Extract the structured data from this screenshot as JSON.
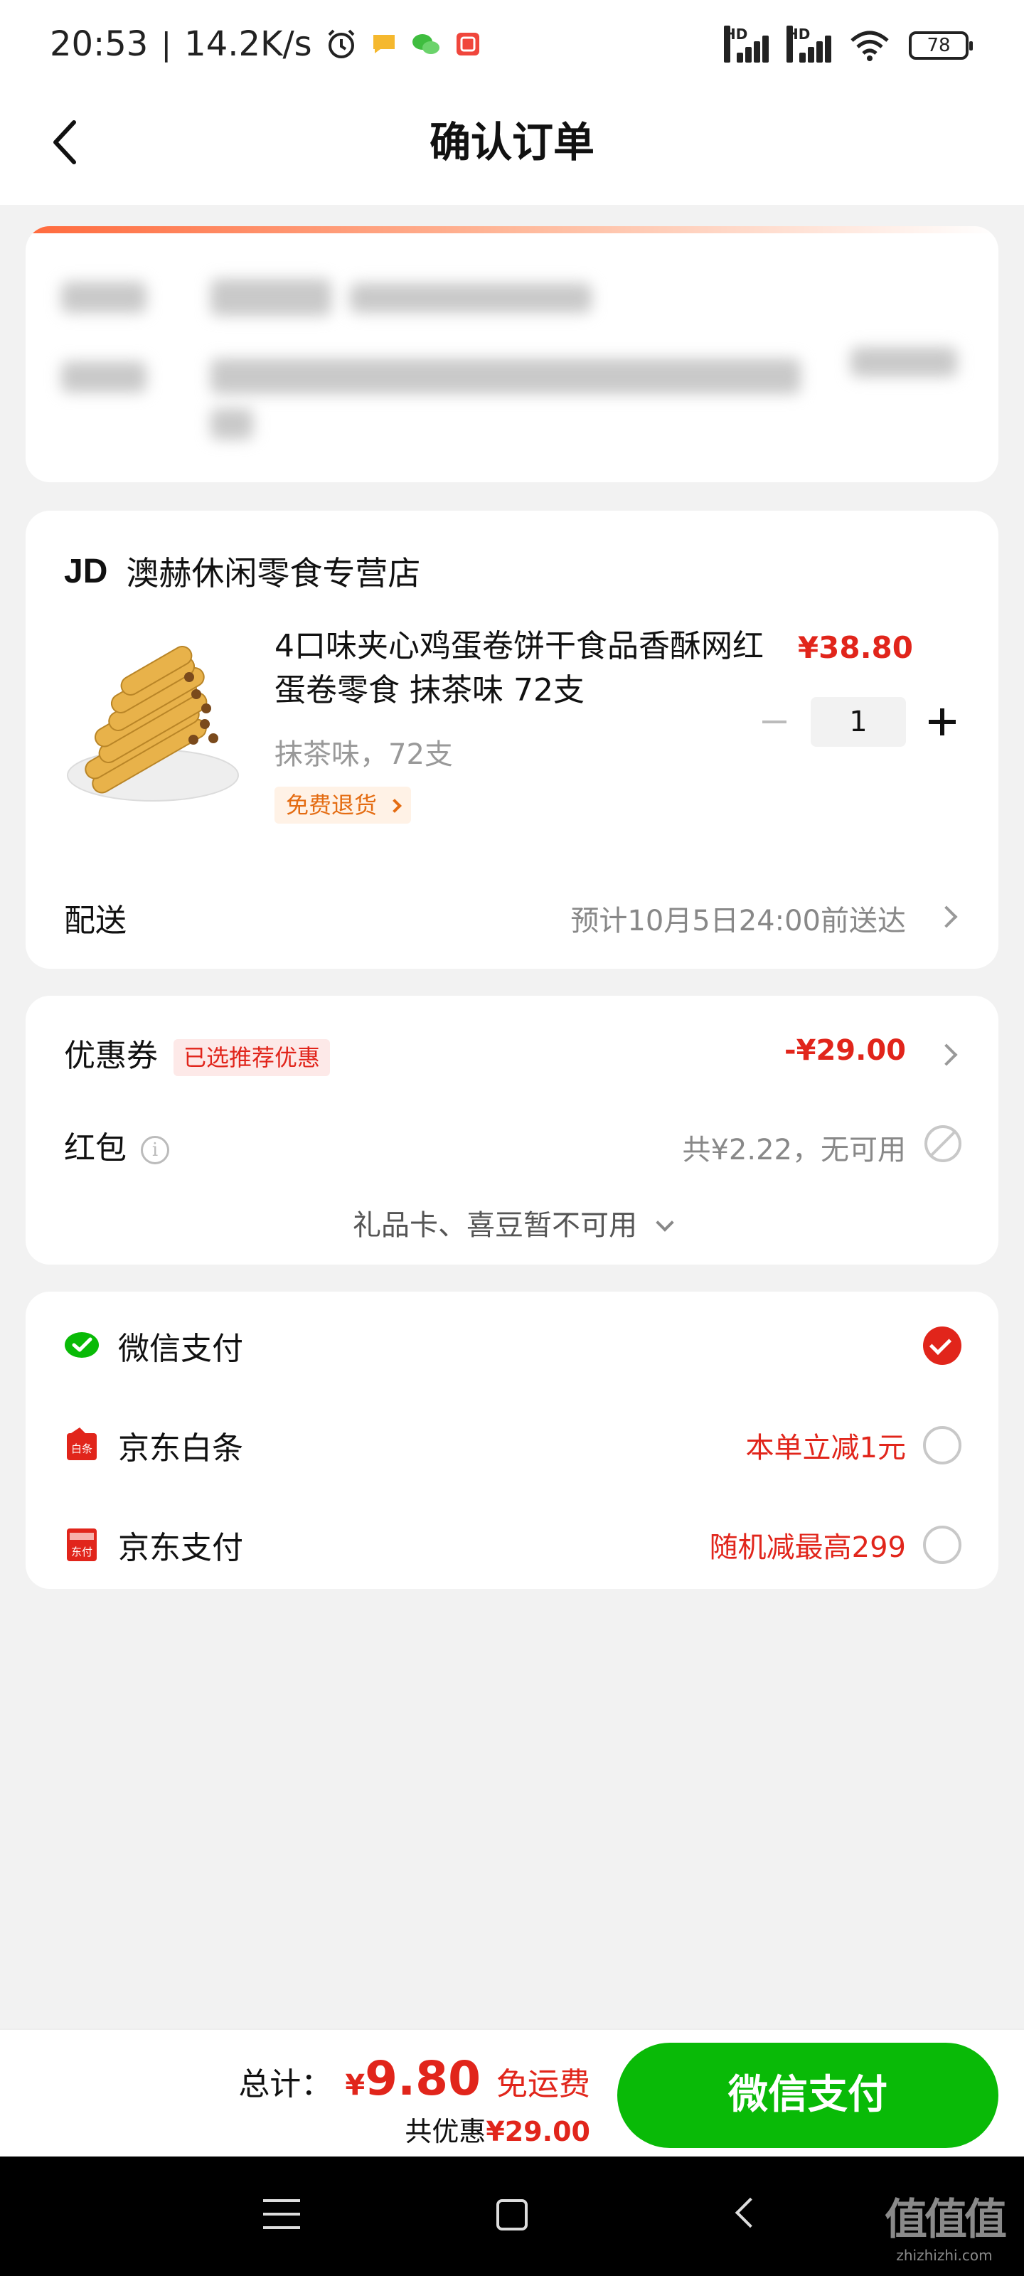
{
  "status_bar": {
    "time": "20:53",
    "net_speed": "14.2K/s",
    "battery": "78",
    "signal_label": "HD"
  },
  "header": {
    "title": "确认订单"
  },
  "store": {
    "logo": "JD",
    "name": "澳赫休闲零食专营店"
  },
  "product": {
    "title": "4口味夹心鸡蛋卷饼干食品香酥网红蛋卷零食 抹茶味 72支",
    "spec": "抹茶味，72支",
    "return_tag": "免费退货",
    "price": "¥38.80",
    "quantity": "1"
  },
  "delivery": {
    "label": "配送",
    "estimate": "预计10月5日24:00前送达"
  },
  "discounts": {
    "coupon_label": "优惠券",
    "coupon_tag": "已选推荐优惠",
    "coupon_amount": "-¥29.00",
    "redpacket_label": "红包",
    "redpacket_info_icon": "i",
    "redpacket_status": "共¥2.22，无可用",
    "giftcard_text": "礼品卡、喜豆暂不可用"
  },
  "payment": {
    "methods": [
      {
        "label": "微信支付",
        "promo": "",
        "icon": "wechat-pay-icon",
        "selected": true
      },
      {
        "label": "京东白条",
        "promo": "本单立减1元",
        "icon": "jd-baitiao-icon",
        "icon_text": "白条",
        "selected": false
      },
      {
        "label": "京东支付",
        "promo": "随机减最高299",
        "icon": "jd-pay-icon",
        "icon_text": "东付",
        "selected": false
      }
    ]
  },
  "footer": {
    "total_label": "总计：",
    "currency": "¥",
    "total_amount": "9.80",
    "shipping": "免运费",
    "discount_label": "共优惠",
    "discount_amount": "¥29.00",
    "pay_button": "微信支付"
  },
  "watermark": {
    "main": "值值值",
    "sub": "zhizhizhi.com"
  },
  "colors": {
    "accent_red": "#e1251b",
    "wechat_green": "#09ba07",
    "background": "#f2f2f2"
  }
}
